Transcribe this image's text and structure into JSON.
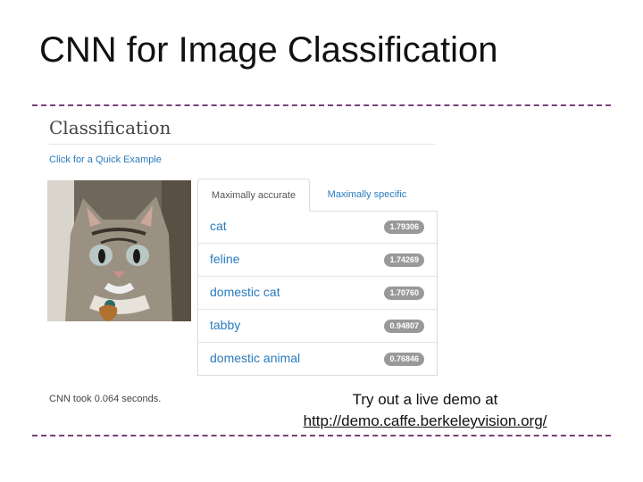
{
  "slide": {
    "title": "CNN for Image Classification"
  },
  "demo": {
    "heading": "Classification",
    "quick_example": "Click for a Quick Example",
    "tabs": [
      {
        "label": "Maximally accurate",
        "active": true
      },
      {
        "label": "Maximally specific",
        "active": false
      }
    ],
    "results": [
      {
        "label": "cat",
        "score": "1.79306"
      },
      {
        "label": "feline",
        "score": "1.74269"
      },
      {
        "label": "domestic cat",
        "score": "1.70760"
      },
      {
        "label": "tabby",
        "score": "0.94807"
      },
      {
        "label": "domestic animal",
        "score": "0.76846"
      }
    ],
    "timing": "CNN took 0.064 seconds."
  },
  "caption": {
    "line1": "Try out a live demo at",
    "url": "http://demo.caffe.berkeleyvision.org/"
  },
  "colors": {
    "accent_link": "#2a7bbd",
    "divider": "#7b3f7b",
    "badge": "#999999"
  }
}
